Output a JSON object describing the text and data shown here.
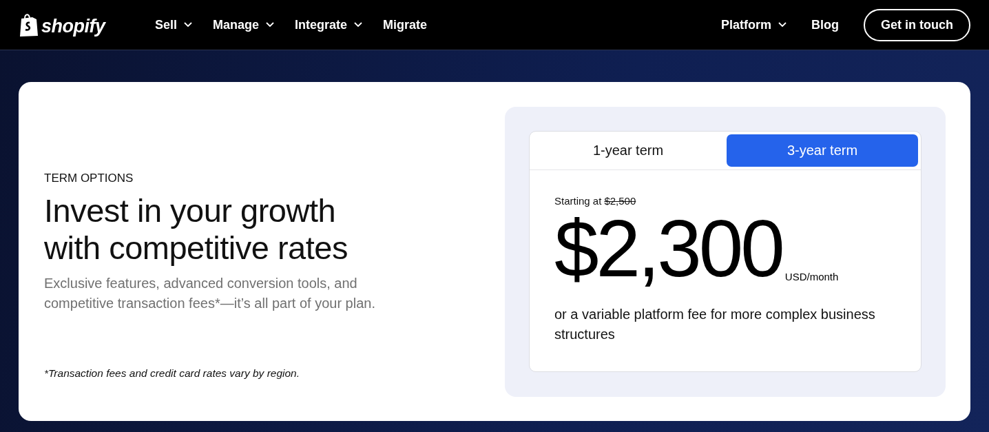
{
  "nav": {
    "logo": "shopify",
    "items": [
      {
        "label": "Sell",
        "has_menu": true
      },
      {
        "label": "Manage",
        "has_menu": true
      },
      {
        "label": "Integrate",
        "has_menu": true
      },
      {
        "label": "Migrate",
        "has_menu": false
      }
    ],
    "right_items": [
      {
        "label": "Platform",
        "has_menu": true
      },
      {
        "label": "Blog",
        "has_menu": false
      }
    ],
    "cta": "Get in touch"
  },
  "section": {
    "eyebrow": "TERM OPTIONS",
    "heading_lines": [
      "Invest in your growth",
      "with competitive rates"
    ],
    "description": "Exclusive features, advanced conversion tools, and competitive transaction fees*—it’s all part of your plan.",
    "footnote": "*Transaction fees and credit card rates vary by region."
  },
  "pricing": {
    "tabs": [
      {
        "label": "1-year term",
        "selected": false
      },
      {
        "label": "3-year term",
        "selected": true
      }
    ],
    "starting_label": "Starting at",
    "original_price": "$2,500",
    "price": "$2,300",
    "unit": "USD/month",
    "note": "or a variable platform fee for more complex business structures"
  }
}
